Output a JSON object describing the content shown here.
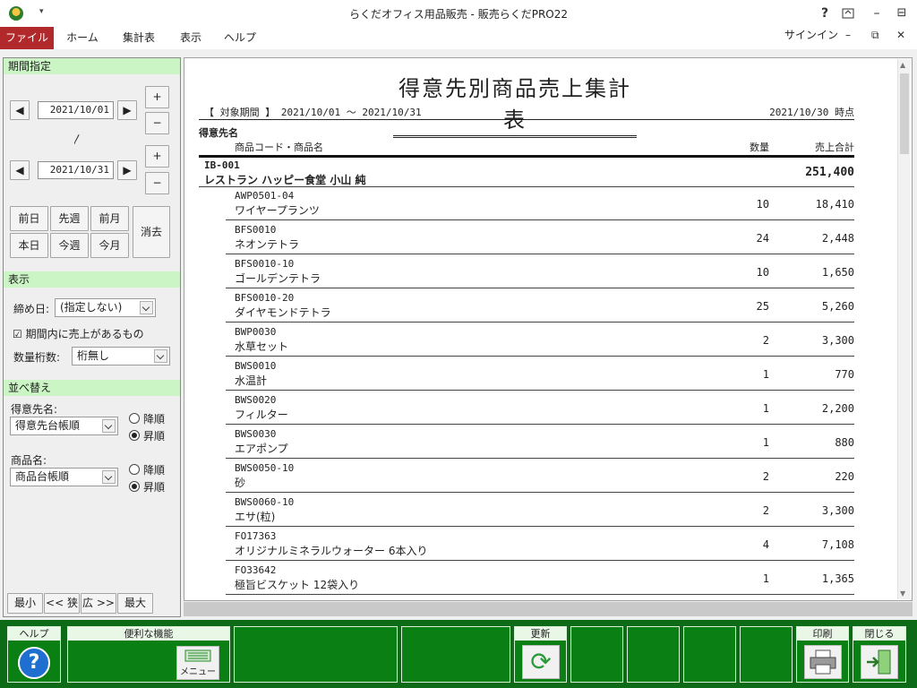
{
  "window": {
    "title": "らくだオフィス用品販売 - 販売らくだPRO22",
    "help": "?",
    "qa_arrow": "▾",
    "restore_down": "⊟"
  },
  "ribbon": {
    "tabs": [
      "ファイル",
      "ホーム",
      "集計表",
      "表示",
      "ヘルプ"
    ],
    "signin": "サインイン",
    "min": "–",
    "restore": "⧉",
    "close": "✕"
  },
  "left": {
    "period_header": "期間指定",
    "date_from": "2021/10/01",
    "date_to": "2021/10/31",
    "tilde": "〳",
    "quick": [
      "前日",
      "先週",
      "前月",
      "本日",
      "今週",
      "今月"
    ],
    "clear": "消去",
    "display_header": "表示",
    "closing_day_label": "締め日:",
    "closing_day_value": "(指定しない)",
    "has_sales_label": "期間内に売上があるもの",
    "qty_digits_label": "数量桁数:",
    "qty_digits_value": "桁無し",
    "sort_header": "並べ替え",
    "customer_label": "得意先名:",
    "customer_sort": "得意先台帳順",
    "product_label": "商品名:",
    "product_sort": "商品台帳順",
    "desc": "降順",
    "asc": "昇順",
    "zoom": [
      "最小",
      "<< 狭",
      "広 >>",
      "最大"
    ]
  },
  "report": {
    "title": "得意先別商品売上集計表",
    "period": "【 対象期間 】 2021/10/01 ～ 2021/10/31",
    "asof": "2021/10/30 時点",
    "hdr_customer": "得意先名",
    "hdr_code": "商品コード・商品名",
    "hdr_qty": "数量",
    "hdr_amount": "売上合計",
    "customer_code": "IB-001",
    "customer_name": "レストラン ハッピー食堂 小山 純",
    "customer_total": "251,400",
    "items": [
      {
        "code": "AWP0501-04",
        "name": "ワイヤープランツ",
        "qty": "10",
        "amount": "18,410"
      },
      {
        "code": "BFS0010",
        "name": "ネオンテトラ",
        "qty": "24",
        "amount": "2,448"
      },
      {
        "code": "BFS0010-10",
        "name": "ゴールデンテトラ",
        "qty": "10",
        "amount": "1,650"
      },
      {
        "code": "BFS0010-20",
        "name": "ダイヤモンドテトラ",
        "qty": "25",
        "amount": "5,260"
      },
      {
        "code": "BWP0030",
        "name": "水草セット",
        "qty": "2",
        "amount": "3,300"
      },
      {
        "code": "BWS0010",
        "name": "水温計",
        "qty": "1",
        "amount": "770"
      },
      {
        "code": "BWS0020",
        "name": "フィルター",
        "qty": "1",
        "amount": "2,200"
      },
      {
        "code": "BWS0030",
        "name": "エアポンプ",
        "qty": "1",
        "amount": "880"
      },
      {
        "code": "BWS0050-10",
        "name": "砂",
        "qty": "2",
        "amount": "220"
      },
      {
        "code": "BWS0060-10",
        "name": "エサ(粒)",
        "qty": "2",
        "amount": "3,300"
      },
      {
        "code": "FO17363",
        "name": "オリジナルミネラルウォーター 6本入り",
        "qty": "4",
        "amount": "7,108"
      },
      {
        "code": "FO33642",
        "name": "極旨ビスケット 12袋入り",
        "qty": "1",
        "amount": "1,365"
      }
    ]
  },
  "footer": {
    "help": "ヘルプ",
    "useful": "便利な機能",
    "menu": "メニュー",
    "refresh": "更新",
    "print": "印刷",
    "close": "閉じる"
  },
  "icons": {
    "left_arrow": "◀",
    "right_arrow": "▶",
    "plus": "+",
    "minus": "−",
    "check": "☑",
    "scroll_up": "▲",
    "scroll_down": "▼",
    "refresh": "⟳"
  },
  "colors": {
    "file_tab": "#b1292b",
    "section_bar": "#ccf5c6",
    "footer_green": "#0d6b17"
  }
}
